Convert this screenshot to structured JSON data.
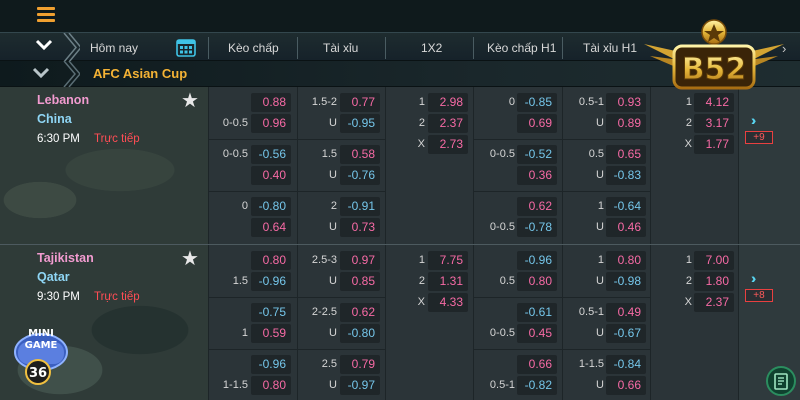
{
  "header": {
    "tabs": [
      "Hôm nay",
      "Kèo chấp",
      "Tài xỉu",
      "1X2",
      "Kèo chấp H1",
      "Tài xỉu H1"
    ]
  },
  "league": {
    "name": "AFC Asian Cup"
  },
  "logo": {
    "text": "B52"
  },
  "minigame": {
    "line1": "MINI",
    "line2": "GAME",
    "badge": "36"
  },
  "matches": [
    {
      "home": "Lebanon",
      "away": "China",
      "time": "6:30 PM",
      "status": "Trực tiếp",
      "more": "+9"
    },
    {
      "home": "Tajikistan",
      "away": "Qatar",
      "time": "9:30 PM",
      "status": "Trực tiếp",
      "more": "+8"
    }
  ],
  "odds": {
    "m1_hdp": [
      [
        "",
        "0.88"
      ],
      [
        "0-0.5",
        "0.96"
      ],
      [
        "0-0.5",
        "-0.56"
      ],
      [
        "",
        "0.40"
      ],
      [
        "0",
        "-0.80"
      ],
      [
        "",
        "0.64"
      ]
    ],
    "m1_ou": [
      [
        "1.5-2",
        "0.77"
      ],
      [
        "U",
        "-0.95"
      ],
      [
        "1.5",
        "0.58"
      ],
      [
        "U",
        "-0.76"
      ],
      [
        "2",
        "-0.91"
      ],
      [
        "U",
        "0.73"
      ]
    ],
    "m1_1x2": [
      [
        "1",
        "2.98"
      ],
      [
        "2",
        "2.37"
      ],
      [
        "X",
        "2.73"
      ]
    ],
    "m1_hdp_h1": [
      [
        "0",
        "-0.85"
      ],
      [
        "",
        "0.69"
      ],
      [
        "0-0.5",
        "-0.52"
      ],
      [
        "",
        "0.36"
      ],
      [
        "",
        "0.62"
      ],
      [
        "0-0.5",
        "-0.78"
      ]
    ],
    "m1_ou_h1": [
      [
        "0.5-1",
        "0.93"
      ],
      [
        "U",
        "0.89"
      ],
      [
        "0.5",
        "0.65"
      ],
      [
        "U",
        "-0.83"
      ],
      [
        "1",
        "-0.64"
      ],
      [
        "U",
        "0.46"
      ]
    ],
    "m1_1x2_h1": [
      [
        "1",
        "4.12"
      ],
      [
        "2",
        "3.17"
      ],
      [
        "X",
        "1.77"
      ]
    ],
    "m2_hdp": [
      [
        "",
        "0.80"
      ],
      [
        "1.5",
        "-0.96"
      ],
      [
        "",
        "-0.75"
      ],
      [
        "1",
        "0.59"
      ],
      [
        "",
        "-0.96"
      ],
      [
        "1-1.5",
        "0.80"
      ]
    ],
    "m2_ou": [
      [
        "2.5-3",
        "0.97"
      ],
      [
        "U",
        "0.85"
      ],
      [
        "2-2.5",
        "0.62"
      ],
      [
        "U",
        "-0.80"
      ],
      [
        "2.5",
        "0.79"
      ],
      [
        "U",
        "-0.97"
      ]
    ],
    "m2_1x2": [
      [
        "1",
        "7.75"
      ],
      [
        "2",
        "1.31"
      ],
      [
        "X",
        "4.33"
      ]
    ],
    "m2_hdp_h1": [
      [
        "",
        "-0.96"
      ],
      [
        "0.5",
        "0.80"
      ],
      [
        "",
        "-0.61"
      ],
      [
        "0-0.5",
        "0.45"
      ],
      [
        "",
        "0.66"
      ],
      [
        "0.5-1",
        "-0.82"
      ]
    ],
    "m2_ou_h1": [
      [
        "1",
        "0.80"
      ],
      [
        "U",
        "-0.98"
      ],
      [
        "0.5-1",
        "0.49"
      ],
      [
        "U",
        "-0.67"
      ],
      [
        "1-1.5",
        "-0.84"
      ],
      [
        "U",
        "0.66"
      ]
    ],
    "m2_1x2_h1": [
      [
        "1",
        "7.00"
      ],
      [
        "2",
        "1.80"
      ],
      [
        "X",
        "2.37"
      ]
    ]
  },
  "colors": {
    "home_team": "#f29bd0",
    "away_team": "#8fd6f5",
    "live": "#ff4d55",
    "league": "#f5b335",
    "odd_positive": "#f76aa5",
    "odd_negative": "#75c6ea"
  }
}
